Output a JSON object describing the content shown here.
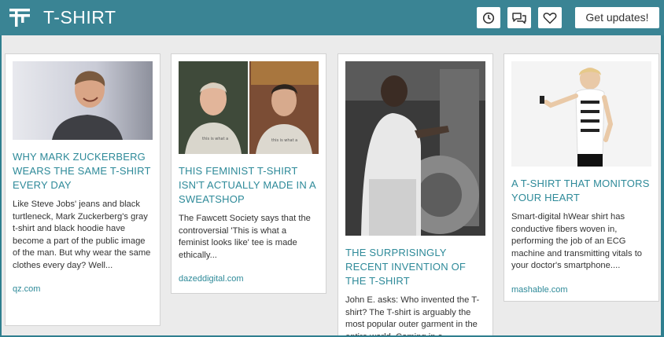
{
  "header": {
    "title": "T-SHIRT",
    "cta_label": "Get updates!",
    "icons": [
      "clock-icon",
      "chat-icon",
      "heart-icon"
    ]
  },
  "cards": [
    {
      "title": "WHY MARK ZUCKERBERG WEARS THE SAME T-SHIRT EVERY DAY",
      "excerpt": "Like Steve Jobs' jeans and black turtleneck, Mark Zuckerberg's gray t-shirt and black hoodie have become a part of the public image of the man. But why wear the same clothes every day? Well...",
      "source": "qz.com"
    },
    {
      "title": "THIS FEMINIST T-SHIRT ISN'T ACTUALLY MADE IN A SWEATSHOP",
      "excerpt": "The Fawcett Society says that the controversial 'This is what a feminist looks like' tee is made ethically...",
      "source": "dazeddigital.com"
    },
    {
      "title": "THE SURPRISINGLY RECENT INVENTION OF THE T-SHIRT",
      "excerpt": "John E. asks: Who invented the T-shirt? The T-shirt is arguably the most popular outer garment in the entire world. Coming in a",
      "source": ""
    },
    {
      "title": "A T-SHIRT THAT MONITORS YOUR HEART",
      "excerpt": "Smart-digital hWear shirt has conductive fibers woven in, performing the job of an ECG machine and transmitting vitals to your doctor's smartphone....",
      "source": "mashable.com"
    }
  ],
  "colors": {
    "header_bg": "#3a8494",
    "accent": "#2e8a99",
    "page_bg": "#ebebeb"
  }
}
